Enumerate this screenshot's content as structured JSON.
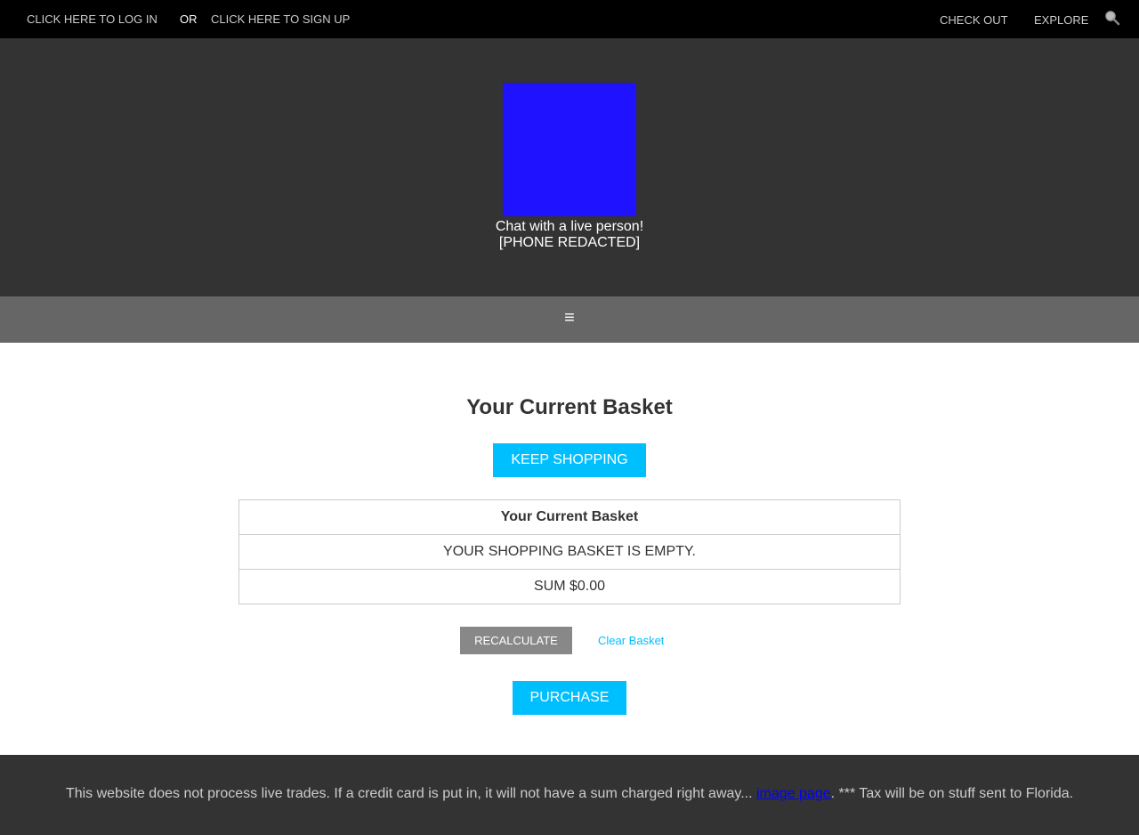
{
  "topbar": {
    "login_link": "CLICK HERE TO LOG IN",
    "or_text": "OR",
    "signup_link": "CLICK HERE TO SIGN UP",
    "checkout_link": "CHECK OUT",
    "explore_link": "EXPLORE",
    "search_icon": "search-icon"
  },
  "hero": {
    "logo_color": "#1e12ff",
    "chat_text": "Chat with a live person!",
    "phone_text": "[PHONE REDACTED]"
  },
  "nav": {
    "menu_icon": "≡"
  },
  "main": {
    "title": "Your Current Basket",
    "keep_shopping_label": "KEEP SHOPPING",
    "table": {
      "header": "Your Current Basket",
      "rows": [
        "YOUR SHOPPING BASKET IS EMPTY.",
        "SUM $0.00"
      ]
    },
    "recalculate_label": "RECALCULATE",
    "clear_basket_label": "Clear Basket",
    "purchase_label": "PURCHASE"
  },
  "footer": {
    "text_before_link": "This website does not process live trades. If a credit card is put in, it will not have a sum charged right away... ",
    "link_text": "image page",
    "text_after_link": ". *** Tax will be on stuff sent to Florida."
  },
  "colors": {
    "accent": "#00bfff",
    "topbar_bg": "#000000",
    "hero_bg": "#333333",
    "nav_bg": "#666666"
  }
}
